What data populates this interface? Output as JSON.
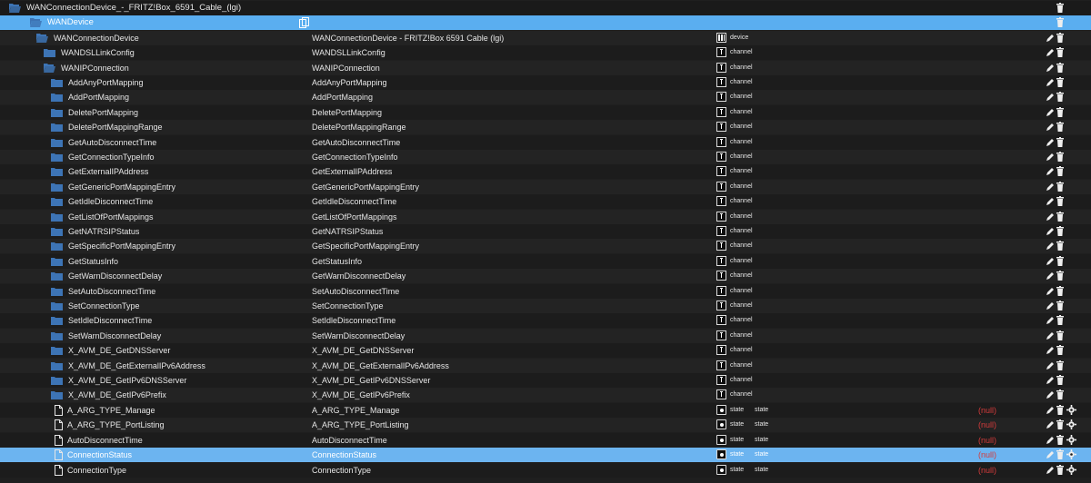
{
  "colors": {
    "folder": "#3d74b5",
    "selected_row": "#6cb4f0",
    "null_value": "#d43b3b"
  },
  "rows": [
    {
      "name": "WANConnectionDevice_-_FRITZ!Box_6591_Cable_(lgi)",
      "desc": "",
      "type": "",
      "role": "",
      "value": "",
      "icon": "folder-open",
      "indent": 10,
      "actions": "del",
      "style": "top"
    },
    {
      "name": "WANDevice",
      "desc": "",
      "type": "",
      "role": "",
      "value": "",
      "icon": "folder-open",
      "indent": 33,
      "actions": "del",
      "style": "top-sel",
      "copy": true
    },
    {
      "name": "WANConnectionDevice",
      "desc": "WANConnectionDevice - FRITZ!Box 6591 Cable (lgi)",
      "type": "device",
      "role": "",
      "value": "",
      "icon": "folder-open",
      "indent": 40,
      "actions": "edit-del"
    },
    {
      "name": "WANDSLLinkConfig",
      "desc": "WANDSLLinkConfig",
      "type": "channel",
      "role": "",
      "value": "",
      "icon": "folder",
      "indent": 48,
      "actions": "edit-del"
    },
    {
      "name": "WANIPConnection",
      "desc": "WANIPConnection",
      "type": "channel",
      "role": "",
      "value": "",
      "icon": "folder-open",
      "indent": 48,
      "actions": "edit-del"
    },
    {
      "name": "AddAnyPortMapping",
      "desc": "AddAnyPortMapping",
      "type": "channel",
      "role": "",
      "value": "",
      "icon": "folder",
      "indent": 56,
      "actions": "edit-del"
    },
    {
      "name": "AddPortMapping",
      "desc": "AddPortMapping",
      "type": "channel",
      "role": "",
      "value": "",
      "icon": "folder",
      "indent": 56,
      "actions": "edit-del"
    },
    {
      "name": "DeletePortMapping",
      "desc": "DeletePortMapping",
      "type": "channel",
      "role": "",
      "value": "",
      "icon": "folder",
      "indent": 56,
      "actions": "edit-del"
    },
    {
      "name": "DeletePortMappingRange",
      "desc": "DeletePortMappingRange",
      "type": "channel",
      "role": "",
      "value": "",
      "icon": "folder",
      "indent": 56,
      "actions": "edit-del"
    },
    {
      "name": "GetAutoDisconnectTime",
      "desc": "GetAutoDisconnectTime",
      "type": "channel",
      "role": "",
      "value": "",
      "icon": "folder",
      "indent": 56,
      "actions": "edit-del"
    },
    {
      "name": "GetConnectionTypeInfo",
      "desc": "GetConnectionTypeInfo",
      "type": "channel",
      "role": "",
      "value": "",
      "icon": "folder",
      "indent": 56,
      "actions": "edit-del"
    },
    {
      "name": "GetExternalIPAddress",
      "desc": "GetExternalIPAddress",
      "type": "channel",
      "role": "",
      "value": "",
      "icon": "folder",
      "indent": 56,
      "actions": "edit-del"
    },
    {
      "name": "GetGenericPortMappingEntry",
      "desc": "GetGenericPortMappingEntry",
      "type": "channel",
      "role": "",
      "value": "",
      "icon": "folder",
      "indent": 56,
      "actions": "edit-del"
    },
    {
      "name": "GetIdleDisconnectTime",
      "desc": "GetIdleDisconnectTime",
      "type": "channel",
      "role": "",
      "value": "",
      "icon": "folder",
      "indent": 56,
      "actions": "edit-del"
    },
    {
      "name": "GetListOfPortMappings",
      "desc": "GetListOfPortMappings",
      "type": "channel",
      "role": "",
      "value": "",
      "icon": "folder",
      "indent": 56,
      "actions": "edit-del"
    },
    {
      "name": "GetNATRSIPStatus",
      "desc": "GetNATRSIPStatus",
      "type": "channel",
      "role": "",
      "value": "",
      "icon": "folder",
      "indent": 56,
      "actions": "edit-del"
    },
    {
      "name": "GetSpecificPortMappingEntry",
      "desc": "GetSpecificPortMappingEntry",
      "type": "channel",
      "role": "",
      "value": "",
      "icon": "folder",
      "indent": 56,
      "actions": "edit-del"
    },
    {
      "name": "GetStatusInfo",
      "desc": "GetStatusInfo",
      "type": "channel",
      "role": "",
      "value": "",
      "icon": "folder",
      "indent": 56,
      "actions": "edit-del"
    },
    {
      "name": "GetWarnDisconnectDelay",
      "desc": "GetWarnDisconnectDelay",
      "type": "channel",
      "role": "",
      "value": "",
      "icon": "folder",
      "indent": 56,
      "actions": "edit-del"
    },
    {
      "name": "SetAutoDisconnectTime",
      "desc": "SetAutoDisconnectTime",
      "type": "channel",
      "role": "",
      "value": "",
      "icon": "folder",
      "indent": 56,
      "actions": "edit-del"
    },
    {
      "name": "SetConnectionType",
      "desc": "SetConnectionType",
      "type": "channel",
      "role": "",
      "value": "",
      "icon": "folder",
      "indent": 56,
      "actions": "edit-del"
    },
    {
      "name": "SetIdleDisconnectTime",
      "desc": "SetIdleDisconnectTime",
      "type": "channel",
      "role": "",
      "value": "",
      "icon": "folder",
      "indent": 56,
      "actions": "edit-del"
    },
    {
      "name": "SetWarnDisconnectDelay",
      "desc": "SetWarnDisconnectDelay",
      "type": "channel",
      "role": "",
      "value": "",
      "icon": "folder",
      "indent": 56,
      "actions": "edit-del"
    },
    {
      "name": "X_AVM_DE_GetDNSServer",
      "desc": "X_AVM_DE_GetDNSServer",
      "type": "channel",
      "role": "",
      "value": "",
      "icon": "folder",
      "indent": 56,
      "actions": "edit-del"
    },
    {
      "name": "X_AVM_DE_GetExternalIPv6Address",
      "desc": "X_AVM_DE_GetExternalIPv6Address",
      "type": "channel",
      "role": "",
      "value": "",
      "icon": "folder",
      "indent": 56,
      "actions": "edit-del"
    },
    {
      "name": "X_AVM_DE_GetIPv6DNSServer",
      "desc": "X_AVM_DE_GetIPv6DNSServer",
      "type": "channel",
      "role": "",
      "value": "",
      "icon": "folder",
      "indent": 56,
      "actions": "edit-del"
    },
    {
      "name": "X_AVM_DE_GetIPv6Prefix",
      "desc": "X_AVM_DE_GetIPv6Prefix",
      "type": "channel",
      "role": "",
      "value": "",
      "icon": "folder",
      "indent": 56,
      "actions": "edit-del"
    },
    {
      "name": "A_ARG_TYPE_Manage",
      "desc": "A_ARG_TYPE_Manage",
      "type": "state",
      "role": "state",
      "value": "(null)",
      "icon": "file",
      "indent": 60,
      "actions": "edit-del-gear"
    },
    {
      "name": "A_ARG_TYPE_PortListing",
      "desc": "A_ARG_TYPE_PortListing",
      "type": "state",
      "role": "state",
      "value": "(null)",
      "icon": "file",
      "indent": 60,
      "actions": "edit-del-gear"
    },
    {
      "name": "AutoDisconnectTime",
      "desc": "AutoDisconnectTime",
      "type": "state",
      "role": "state",
      "value": "(null)",
      "icon": "file",
      "indent": 60,
      "actions": "edit-del-gear"
    },
    {
      "name": "ConnectionStatus",
      "desc": "ConnectionStatus",
      "type": "state",
      "role": "state",
      "value": "(null)",
      "icon": "file",
      "indent": 60,
      "actions": "edit-del-gear",
      "style": "selected"
    },
    {
      "name": "ConnectionType",
      "desc": "ConnectionType",
      "type": "state",
      "role": "state",
      "value": "(null)",
      "icon": "file",
      "indent": 60,
      "actions": "edit-del-gear"
    }
  ]
}
